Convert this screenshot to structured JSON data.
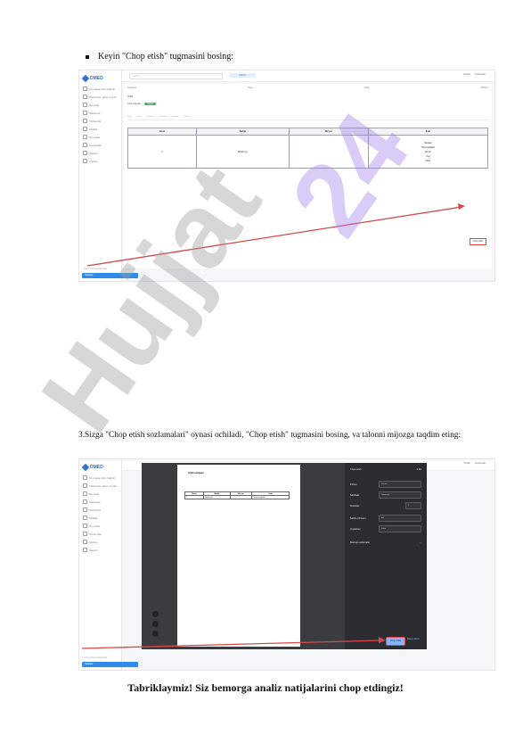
{
  "step2": {
    "text": "Keyin \"Chop etish\" tugmasini bosing:"
  },
  "app": {
    "brand": "DMED",
    "sidebar_items": [
      "Ro'yxatga olish (Qabul)",
      "Shifokorlar qabul ro'yxati",
      "Bemorlar",
      "Statsionar",
      "Shifokorlar",
      "Tahlillar",
      "Ro'yxatlar",
      "Sozlamalar",
      "Hisobot",
      "Chiqish"
    ],
    "footer_gray": "Chop etish sozlamalari",
    "footer_chip": "Natijalar",
    "search_placeholder": "Qidiruv",
    "search_button": "Qidirish",
    "top_right": [
      "Yordam",
      "Sozlamalar"
    ],
    "info": [
      "Tekshiruv",
      "Sana",
      "Holat",
      "Shifokor"
    ],
    "subhead": "Tahlil",
    "subhead2": "Tahlil natijalari",
    "status_pill": "Tayyor",
    "toolbar": [
      "Fayl",
      "Tahrir",
      "Ko'rinish",
      "Qo'shish",
      "Format",
      "Jadval"
    ],
    "table_headers": [
      "Nomi",
      "Natija",
      "Me'yor",
      "Izoh"
    ],
    "table_row": {
      "num": "1",
      "name": "Biokimyo",
      "lines": [
        "Natijalar",
        "Tahlil natijalari",
        "Me'yor",
        "Izoh",
        "Holat"
      ]
    },
    "print_button": "Chop etish"
  },
  "step3": {
    "number": "3.",
    "text": "Sizga \"Chop etish sozlamalari\" oynasi ochiladi, \"Chop etish\" tugmasini bosing, va talonni mijozga taqdim eting:"
  },
  "print_dialog": {
    "title": "Chop etish",
    "count": "1 list",
    "preview_title": "Tahlil natijalari",
    "rows": [
      {
        "label": "Printer",
        "value": "Printer"
      },
      {
        "label": "Sahifalar",
        "value": "Hammasi"
      },
      {
        "label": "Nusxalar",
        "value": "1"
      },
      {
        "label": "Sahifa o'lchami",
        "value": "A4"
      },
      {
        "label": "Joylashuv",
        "value": "Kitob"
      }
    ],
    "more": "Boshqa sozlamalar",
    "print_btn": "Chop etish",
    "cancel_btn": "Bekor qilish"
  },
  "final_text": "Tabriklaymiz! Siz bemorga analiz natijalarini chop etdingiz!",
  "watermark": {
    "word1": "Hujjat",
    "word2": "24"
  }
}
